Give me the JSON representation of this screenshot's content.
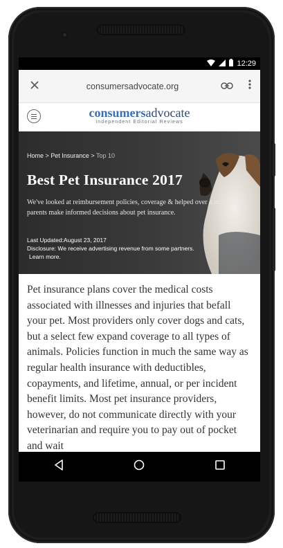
{
  "status_bar": {
    "time": "12:29"
  },
  "toolbar": {
    "url": "consumersadvocate.org"
  },
  "site": {
    "logo_part1": "consumers",
    "logo_part2": "advocate",
    "tagline": "Independent Editorial Reviews"
  },
  "hero": {
    "breadcrumb_home": "Home",
    "breadcrumb_sep1": " > ",
    "breadcrumb_section": "Pet Insurance",
    "breadcrumb_sep2": " > ",
    "breadcrumb_current": "Top 10",
    "title": "Best Pet Insurance 2017",
    "description": "We've looked at reimbursement policies, coverage & helped over a million pet parents make informed decisions about pet insurance.",
    "updated": "Last Updated:August 23, 2017",
    "disclosure": "Disclosure: We receive advertising revenue from some partners.",
    "learn_more": "Learn more."
  },
  "article": {
    "body": "Pet insurance plans cover the medical costs associated with illnesses and injuries that befall your pet. Most providers only cover dogs and cats, but a select few expand coverage to all types of animals. Policies function in much the same way as regular health insurance with deductibles, copayments, and lifetime, annual, or per incident benefit limits. Most pet insurance providers, however, do not communicate directly with your veterinarian and require you to pay out of pocket and wait"
  },
  "icons": {
    "close": "close-icon",
    "link": "link-icon",
    "menu": "more-vert-icon",
    "hamburger": "hamburger-icon",
    "back": "back-triangle-icon",
    "home": "home-circle-icon",
    "recents": "recents-square-icon",
    "wifi": "wifi-icon",
    "signal": "signal-icon",
    "battery": "battery-icon"
  },
  "colors": {
    "logo_blue": "#3b6fb0",
    "logo_navy": "#2d4a75",
    "hero_bg": "#333333"
  }
}
